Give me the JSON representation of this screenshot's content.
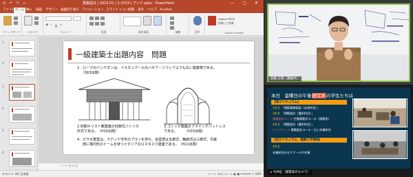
{
  "ppt": {
    "quick_access": "⟲ ↶ ↷ ▭",
    "window_title": "建築設計 | 2022.01 | 1-2019 | アンド.pptx - PowerPoint",
    "window_buttons": "— ▢ ✕",
    "tabs": [
      "ファイル",
      "ホーム",
      "挿入",
      "描画",
      "デザイン",
      "画面切り替え",
      "アニメーション",
      "スライド ショー",
      "校閲",
      "表示",
      "ヘルプ",
      "Acrobat"
    ],
    "active_tab_index": 1,
    "ribbon_groups": [
      "クリップボード",
      "スライド",
      "フォント",
      "段落",
      "図形描画",
      "編集",
      "音声",
      "Adobe Acrobat"
    ],
    "ribbon_right": [
      "Adobe PDFを",
      "作成して共有",
      "Adobe Acrobat"
    ],
    "slide_numbers": [
      "1",
      "2",
      "3",
      "4",
      "5",
      "6"
    ],
    "notes_placeholder": "ノートを入力",
    "status_left": "スライド 3/8   日本語",
    "status_right": "ノート   コメント   ▭  ▦  ▣  ━━━━━━ +  58%"
  },
  "slide": {
    "title": "一級建築士出題内容　問題",
    "q1": "1．ローマのパンテオンは、イスタンブールのハギア・ソフィアよりも広い建築物である。",
    "q1_note": "（S63出題）",
    "q2a": "2.初期キリスト教建築の柱廊式バシリカ",
    "q2b": "形式である。　（H15出題）",
    "q3a": "3.ゴシック建築のフライングバットレス",
    "q3b": "である。　　　（H15出題）",
    "q4a": "4．ピサ大聖堂は、ラテン十字形のプランを持ち、会堂部は五廊式、軸線式は三廊式、交差",
    "q4b": "部に楕円形のドームを持つイタリアのロマネスク建築である。　（H21出題）"
  },
  "cam1": {
    "name": "武藤 正明（講義中）"
  },
  "cam2": {
    "title_pre": "本日　金曜日の午後",
    "title_highlight": "経営系",
    "title_post": "の学生たちは",
    "sec1": "【現カリキュラム】",
    "items1": [
      [
        "2年生",
        "「建築基礎製図（必修科目）」"
      ],
      [
        "3年生",
        "「建築設計（選択科目）」"
      ],
      [
        "建築設計コース",
        "空間建築学コース（建築系）"
      ],
      [
        "4年生",
        "「建築設計（選択科目）」"
      ],
      [
        "ハイブリッド",
        "建築設計コース・主に卒業研究"
      ]
    ],
    "sec2": "【旧カリキュラム　建築工学領域】",
    "items2": [
      [
        "4年生",
        ""
      ],
      [
        "卒業研究のゼミナールや作業",
        ""
      ]
    ],
    "name": "▸ 今井紅（建築系のカメラ）"
  },
  "colors": {
    "ppt_red": "#b7472a",
    "accent": "#c0392b",
    "highlight": "#e74c3c",
    "section": "#f39c12",
    "board_bg": "#0a3650"
  }
}
